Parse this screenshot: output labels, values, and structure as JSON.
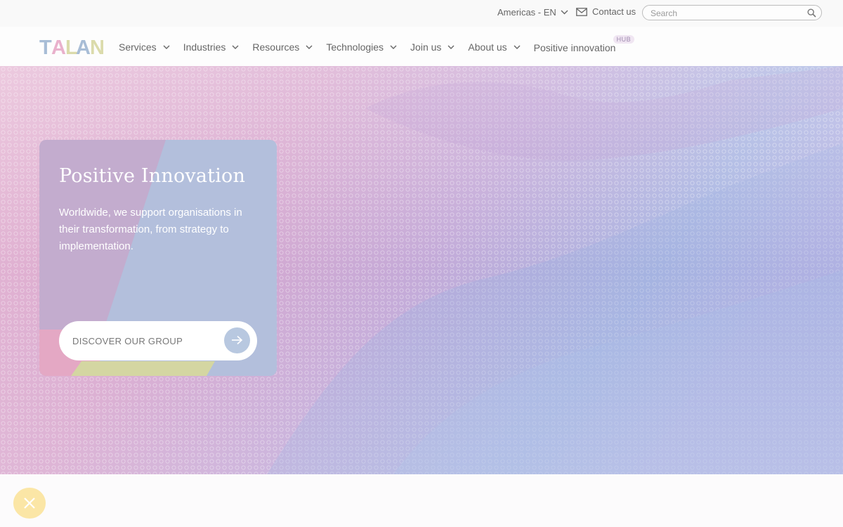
{
  "topbar": {
    "region_label": "Americas - EN",
    "contact_label": "Contact us",
    "search_placeholder": "Search"
  },
  "brand": {
    "logo_text": "TALAN",
    "logo_colors": [
      "#9fb6d2",
      "#e7a8c6",
      "#d9d9a6",
      "#9fb6d2",
      "#d9d9a6"
    ]
  },
  "nav": {
    "items": [
      {
        "label": "Services"
      },
      {
        "label": "Industries"
      },
      {
        "label": "Resources"
      },
      {
        "label": "Technologies"
      },
      {
        "label": "Join us"
      },
      {
        "label": "About us"
      }
    ],
    "positive_label": "Positive innovation",
    "hub_badge": "HUB"
  },
  "hero": {
    "title": "Positive Innovation",
    "description": "Worldwide, we support organisations in their transformation, from strategy to implementation.",
    "cta_label": "DISCOVER OUR GROUP"
  },
  "colors": {
    "pink": "#e7a8c6",
    "blue": "#b8c8e0",
    "olive": "#d9d9a6",
    "yellow": "#fbe6a6"
  },
  "icons": {
    "region": "chevron-down-icon",
    "contact": "mail-icon",
    "search": "search-icon",
    "cta": "arrow-right-icon",
    "close": "close-icon"
  }
}
